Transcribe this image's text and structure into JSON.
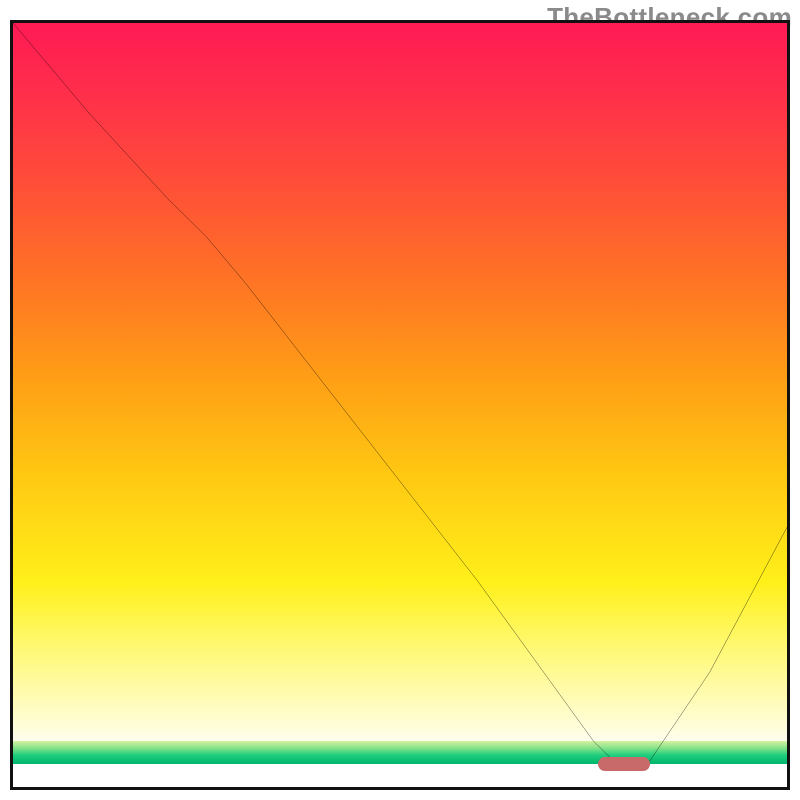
{
  "watermark": "TheBottleneck.com",
  "colors": {
    "gradient_top": "#ff1a55",
    "gradient_mid1": "#ff7a22",
    "gradient_mid2": "#ffc812",
    "gradient_mid3": "#fff01a",
    "gradient_bottom": "#fffdd0",
    "green_top": "#d6f2a0",
    "green_bottom": "#00b76e",
    "curve": "#000000",
    "marker": "#c96a6a",
    "frame": "#111111"
  },
  "chart_data": {
    "type": "line",
    "title": "",
    "xlabel": "",
    "ylabel": "",
    "xlim": [
      0,
      100
    ],
    "ylim": [
      0,
      100
    ],
    "grid": false,
    "axes_visible": false,
    "background": "vertical red→yellow→green gradient (red=high bottleneck, green=low)",
    "series": [
      {
        "name": "bottleneck-curve",
        "x": [
          0,
          10,
          20,
          25,
          30,
          40,
          50,
          60,
          70,
          75,
          78,
          80,
          82,
          90,
          100
        ],
        "values": [
          100,
          88,
          77,
          72,
          66,
          53,
          40,
          27,
          13,
          6,
          3,
          3,
          3,
          15,
          34
        ]
      }
    ],
    "annotations": [
      {
        "name": "optimal-point-marker",
        "x": 79,
        "y": 3,
        "shape": "rounded-bar",
        "color": "#c96a6a"
      }
    ],
    "notes": "No numeric axis tick labels are shown on screen; values estimated proportionally from plot extents."
  }
}
